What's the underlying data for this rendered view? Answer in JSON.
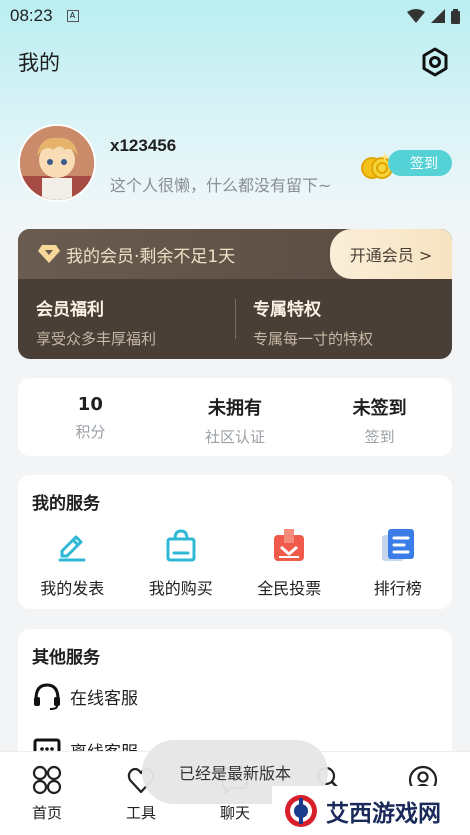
{
  "status_bar": {
    "time": "08:23",
    "sim_label": "A"
  },
  "header": {
    "title": "我的"
  },
  "profile": {
    "username": "x123456",
    "bio": "这个人很懒，什么都没有留下~",
    "checkin_label": "签到"
  },
  "vip": {
    "status": "我的会员·剩余不足1天",
    "open_label": "开通会员 >",
    "benefits": {
      "title": "会员福利",
      "desc": "享受众多丰厚福利"
    },
    "privileges": {
      "title": "专属特权",
      "desc": "专属每一寸的特权"
    }
  },
  "stats": [
    {
      "value": "10",
      "label": "积分"
    },
    {
      "value": "未拥有",
      "label": "社区认证"
    },
    {
      "value": "未签到",
      "label": "签到"
    }
  ],
  "my_services": {
    "title": "我的服务",
    "items": [
      {
        "label": "我的发表",
        "icon": "pencil-icon"
      },
      {
        "label": "我的购买",
        "icon": "shopping-bag-icon"
      },
      {
        "label": "全民投票",
        "icon": "vote-box-icon"
      },
      {
        "label": "排行榜",
        "icon": "ranking-document-icon"
      }
    ]
  },
  "other_services": {
    "title": "其他服务",
    "items": [
      {
        "label": "在线客服",
        "icon": "headset-icon"
      },
      {
        "label": "离线客服",
        "icon": "chat-icon"
      }
    ]
  },
  "tabbar": [
    {
      "label": "首页",
      "icon": "home-grid-icon"
    },
    {
      "label": "工具",
      "icon": "tools-heart-icon"
    },
    {
      "label": "聊天",
      "icon": "chat-bubble-icon"
    },
    {
      "label": "",
      "icon": "community-icon"
    },
    {
      "label": "",
      "icon": "profile-icon"
    }
  ],
  "toast": "已经是最新版本",
  "watermark": "艾西游戏网",
  "colors": {
    "accent": "#54d2d6",
    "vip_bg": "#4a3f36",
    "vip_gold": "#f7e3c2",
    "vote_red": "#ef5a4a",
    "rank_blue": "#3a7de8"
  }
}
